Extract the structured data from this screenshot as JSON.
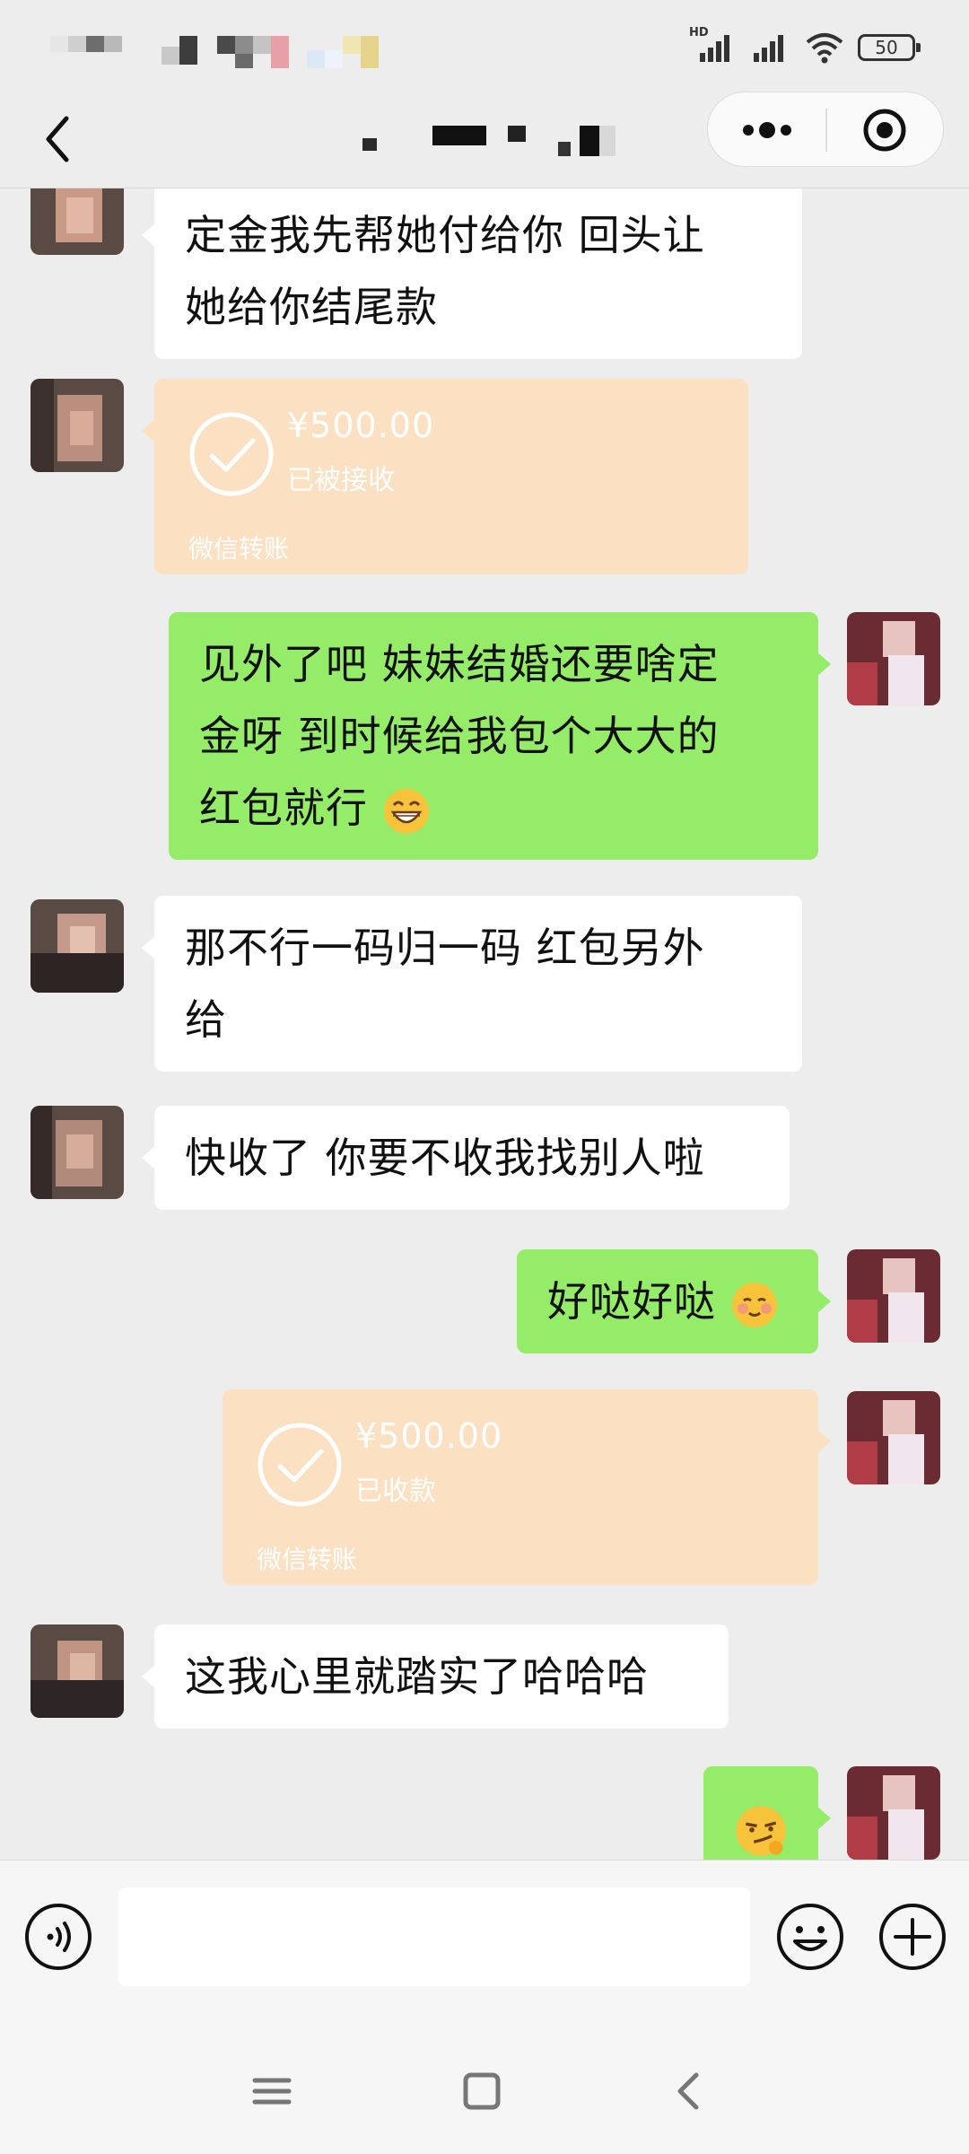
{
  "status_bar": {
    "network_label": "HD",
    "battery_level": "50"
  },
  "nav": {
    "back_icon": "chevron-left-icon",
    "more_icon": "more-dots-icon",
    "close_icon": "target-close-icon"
  },
  "messages": [
    {
      "side": "left",
      "type": "text",
      "lines": [
        "定金我先帮她付给你 回头让",
        "她给你结尾款"
      ]
    },
    {
      "side": "left",
      "type": "transfer",
      "amount": "¥500.00",
      "status": "已被接收",
      "label": "微信转账"
    },
    {
      "side": "right",
      "type": "text",
      "lines": [
        "见外了吧  妹妹结婚还要啥定",
        "金呀 到时候给我包个大大的",
        "红包就行"
      ],
      "emoji": "grinning-emoji"
    },
    {
      "side": "left",
      "type": "text",
      "lines": [
        "那不行一码归一码 红包另外",
        "给"
      ]
    },
    {
      "side": "left",
      "type": "text",
      "lines": [
        "快收了 你要不收我找别人啦"
      ]
    },
    {
      "side": "right",
      "type": "text",
      "lines": [
        "好哒好哒"
      ],
      "emoji": "blush-emoji"
    },
    {
      "side": "right",
      "type": "transfer",
      "amount": "¥500.00",
      "status": "已收款",
      "label": "微信转账"
    },
    {
      "side": "left",
      "type": "text",
      "lines": [
        "这我心里就踏实了哈哈哈"
      ]
    },
    {
      "side": "right",
      "type": "emoji",
      "emoji": "smirk-emoji"
    }
  ],
  "input_bar": {
    "voice_icon": "voice-icon",
    "placeholder": "",
    "emoji_icon": "emoji-icon",
    "plus_icon": "plus-icon"
  },
  "colors": {
    "self_bubble": "#95ec69",
    "other_bubble": "#ffffff",
    "transfer": "#fbe0c2",
    "background": "#ededed"
  }
}
